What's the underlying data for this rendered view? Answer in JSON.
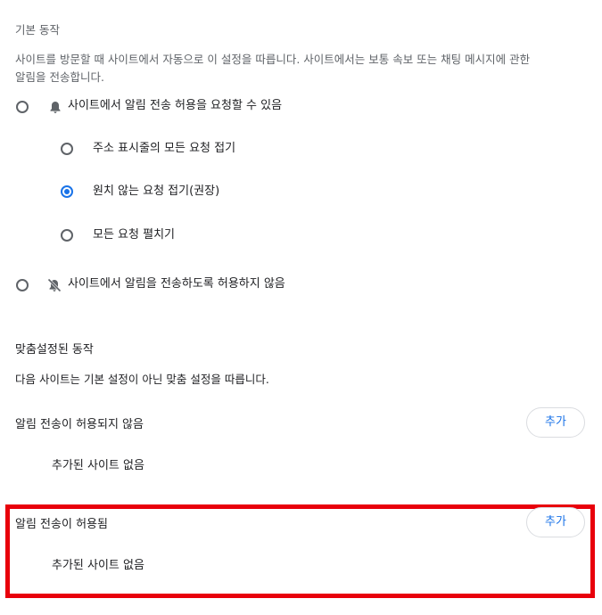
{
  "default_behavior": {
    "title": "기본 동작",
    "description_line1": "사이트를 방문할 때 사이트에서 자동으로 이 설정을 따릅니다. 사이트에서는 보통 속보 또는 채팅 메시지에 관한",
    "description_line2": "알림을 전송합니다.",
    "allow_option": {
      "label": "사이트에서 알림 전송 허용을 요청할 수 있음",
      "icon": "bell-icon",
      "selected": false
    },
    "sub_options": [
      {
        "label": "주소 표시줄의 모든 요청 접기",
        "selected": false
      },
      {
        "label": "원치 않는 요청 접기(권장)",
        "selected": true
      },
      {
        "label": "모든 요청 펼치기",
        "selected": false
      }
    ],
    "block_option": {
      "label": "사이트에서 알림을 전송하도록 허용하지 않음",
      "icon": "bell-off-icon",
      "selected": false
    }
  },
  "custom_behavior": {
    "title": "맞춤설정된 동작",
    "description": "다음 사이트는 기본 설정이 아닌 맞춤 설정을 따릅니다.",
    "not_allowed": {
      "title": "알림 전송이 허용되지 않음",
      "add_label": "추가",
      "empty_text": "추가된 사이트 없음"
    },
    "allowed": {
      "title": "알림 전송이 허용됨",
      "add_label": "추가",
      "empty_text": "추가된 사이트 없음"
    }
  },
  "colors": {
    "accent": "#1a73e8",
    "highlight": "#e8000b",
    "text_primary": "#202124",
    "text_secondary": "#5f6368"
  }
}
